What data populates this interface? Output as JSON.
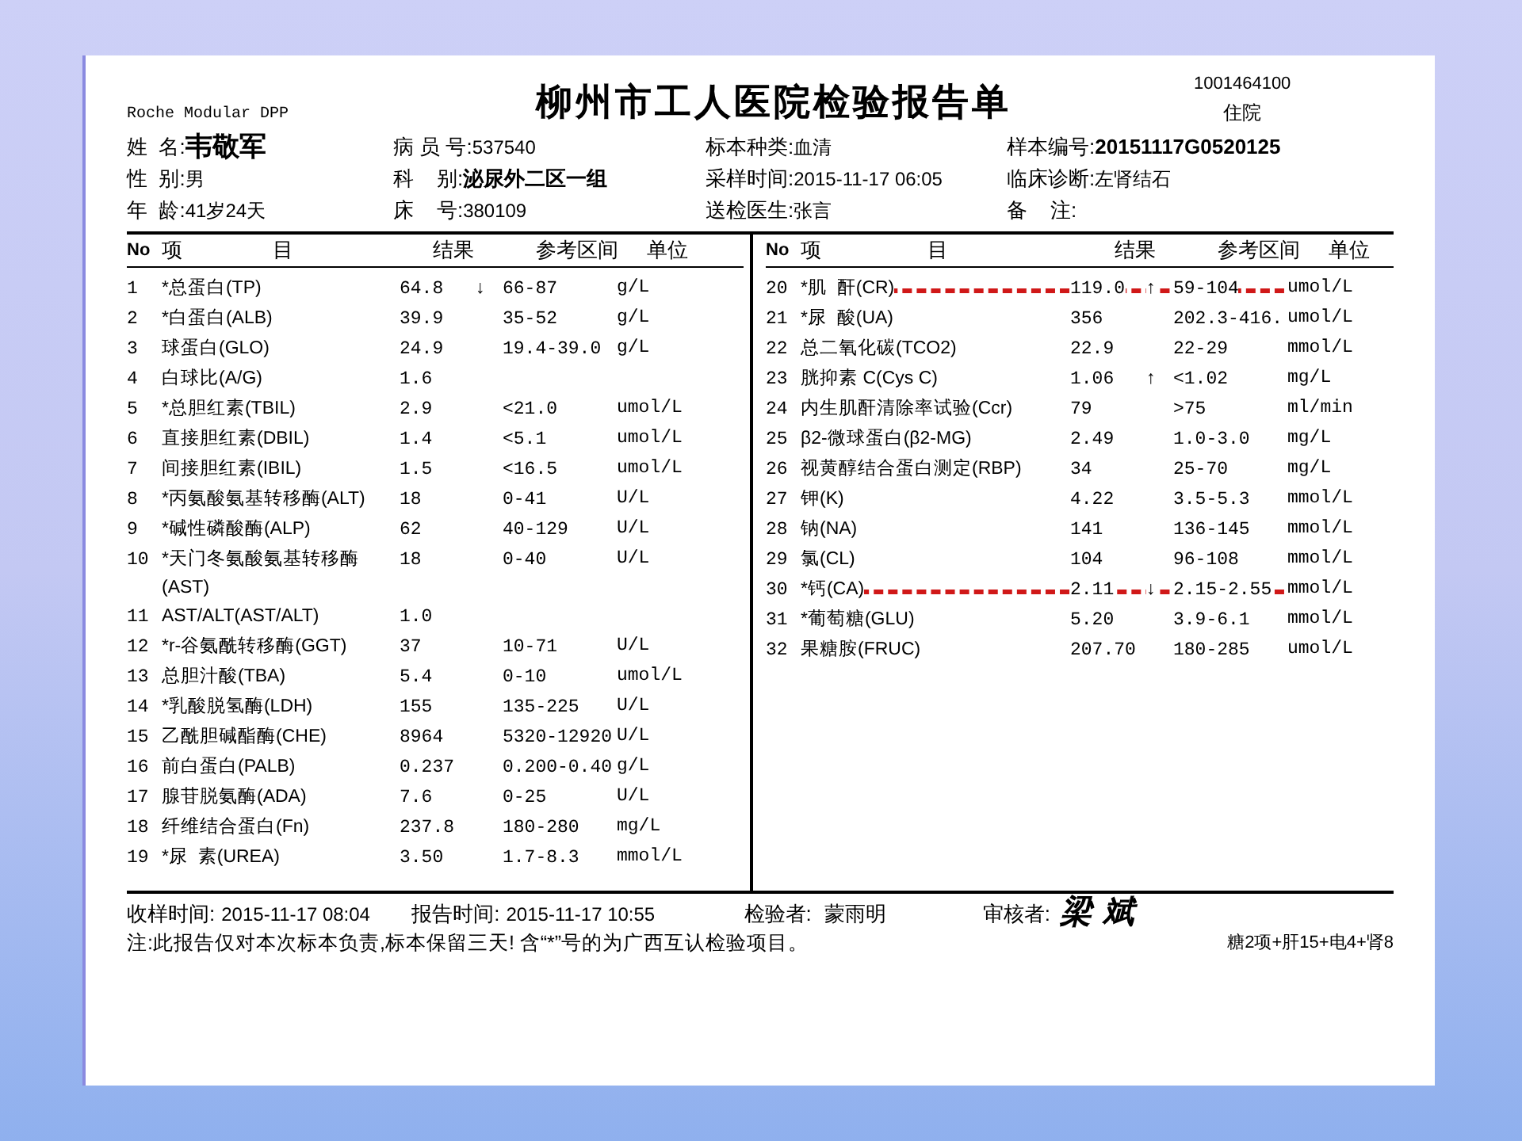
{
  "header": {
    "instrument": "Roche Modular DPP",
    "title": "柳州市工人医院检验报告单",
    "barcode": "1001464100",
    "visit_type": "住院"
  },
  "patient_info": [
    [
      {
        "label": "姓  名:",
        "value": "韦敬军"
      },
      {
        "label": "病 员 号:",
        "value": "537540"
      },
      {
        "label": "标本种类:",
        "value": "血清"
      },
      {
        "label": "样本编号:",
        "value": "20151117G0520125"
      }
    ],
    [
      {
        "label": "性  别:",
        "value": "男"
      },
      {
        "label": "科    别:",
        "value": "泌尿外二区一组"
      },
      {
        "label": "采样时间:",
        "value": "2015-11-17 06:05"
      },
      {
        "label": "临床诊断:",
        "value": "左肾结石"
      }
    ],
    [
      {
        "label": "年  龄:",
        "value": "41岁24天"
      },
      {
        "label": "床    号:",
        "value": "380109"
      },
      {
        "label": "送检医生:",
        "value": "张言"
      },
      {
        "label": "备    注:"
      }
    ]
  ],
  "tables": [
    {
      "columns": [
        "No",
        "项",
        "目",
        "结果",
        "参考区间",
        "单位"
      ],
      "rows": [
        {
          "no": "1",
          "item": "*总蛋白(TP)",
          "result": "64.8",
          "flag": "↓",
          "range": "66-87",
          "unit": "g/L",
          "struck": false
        },
        {
          "no": "2",
          "item": "*白蛋白(ALB)",
          "result": "39.9",
          "range": "35-52",
          "unit": "g/L",
          "struck": false
        },
        {
          "no": "3",
          "item": "球蛋白(GLO)",
          "result": "24.9",
          "range": "19.4-39.0",
          "unit": "g/L",
          "struck": false
        },
        {
          "no": "4",
          "item": "白球比(A/G)",
          "result": "1.6",
          "struck": false
        },
        {
          "no": "5",
          "item": "*总胆红素(TBIL)",
          "result": "2.9",
          "range": "<21.0",
          "unit": "umol/L",
          "struck": false
        },
        {
          "no": "6",
          "item": "直接胆红素(DBIL)",
          "result": "1.4",
          "range": "<5.1",
          "unit": "umol/L",
          "struck": false
        },
        {
          "no": "7",
          "item": "间接胆红素(IBIL)",
          "result": "1.5",
          "range": "<16.5",
          "unit": "umol/L",
          "struck": false
        },
        {
          "no": "8",
          "item": "*丙氨酸氨基转移酶(ALT)",
          "result": "18",
          "range": "0-41",
          "unit": "U/L",
          "struck": false
        },
        {
          "no": "9",
          "item": "*碱性磷酸酶(ALP)",
          "result": "62",
          "range": "40-129",
          "unit": "U/L",
          "struck": false
        },
        {
          "no": "10",
          "item": "*天门冬氨酸氨基转移酶(AST)",
          "result": "18",
          "range": "0-40",
          "unit": "U/L",
          "struck": false
        },
        {
          "no": "11",
          "item": "AST/ALT(AST/ALT)",
          "result": "1.0",
          "struck": false
        },
        {
          "no": "12",
          "item": "*r-谷氨酰转移酶(GGT)",
          "result": "37",
          "range": "10-71",
          "unit": "U/L",
          "struck": false
        },
        {
          "no": "13",
          "item": "总胆汁酸(TBA)",
          "result": "5.4",
          "range": "0-10",
          "unit": "umol/L",
          "struck": false
        },
        {
          "no": "14",
          "item": "*乳酸脱氢酶(LDH)",
          "result": "155",
          "range": "135-225",
          "unit": "U/L",
          "struck": false
        },
        {
          "no": "15",
          "item": "乙酰胆碱酯酶(CHE)",
          "result": "8964",
          "range": "5320-12920",
          "unit": "U/L",
          "struck": false
        },
        {
          "no": "16",
          "item": "前白蛋白(PALB)",
          "result": "0.237",
          "range": "0.200-0.40",
          "unit": "g/L",
          "struck": false
        },
        {
          "no": "17",
          "item": "腺苷脱氨酶(ADA)",
          "result": "7.6",
          "range": "0-25",
          "unit": "U/L",
          "struck": false
        },
        {
          "no": "18",
          "item": "纤维结合蛋白(Fn)",
          "result": "237.8",
          "range": "180-280",
          "unit": "mg/L",
          "struck": false
        },
        {
          "no": "19",
          "item": "*尿  素(UREA)",
          "result": "3.50",
          "range": "1.7-8.3",
          "unit": "mmol/L",
          "struck": false
        }
      ]
    },
    {
      "columns": [
        "No",
        "项",
        "目",
        "结果",
        "参考区间",
        "单位"
      ],
      "rows": [
        {
          "no": "20",
          "item": "*肌  酐(CR)",
          "result": "119.0",
          "flag": "↑",
          "range": "59-104",
          "unit": "umol/L",
          "struck": true
        },
        {
          "no": "21",
          "item": "*尿  酸(UA)",
          "result": "356",
          "range": "202.3-416.",
          "unit": "umol/L",
          "struck": false
        },
        {
          "no": "22",
          "item": "总二氧化碳(TCO2)",
          "result": "22.9",
          "range": "22-29",
          "unit": "mmol/L",
          "struck": false
        },
        {
          "no": "23",
          "item": "胱抑素 C(Cys C)",
          "result": "1.06",
          "flag": "↑",
          "range": "<1.02",
          "unit": "mg/L",
          "struck": false
        },
        {
          "no": "24",
          "item": "内生肌酐清除率试验(Ccr)",
          "result": "79",
          "range": ">75",
          "unit": "ml/min",
          "struck": false
        },
        {
          "no": "25",
          "item": "β2-微球蛋白(β2-MG)",
          "result": "2.49",
          "range": "1.0-3.0",
          "unit": "mg/L",
          "struck": false
        },
        {
          "no": "26",
          "item": "视黄醇结合蛋白测定(RBP)",
          "result": "34",
          "range": "25-70",
          "unit": "mg/L",
          "struck": false
        },
        {
          "no": "27",
          "item": "钾(K)",
          "result": "4.22",
          "range": "3.5-5.3",
          "unit": "mmol/L",
          "struck": false
        },
        {
          "no": "28",
          "item": "钠(NA)",
          "result": "141",
          "range": "136-145",
          "unit": "mmol/L",
          "struck": false
        },
        {
          "no": "29",
          "item": "氯(CL)",
          "result": "104",
          "range": "96-108",
          "unit": "mmol/L",
          "struck": false
        },
        {
          "no": "30",
          "item": "*钙(CA)",
          "result": "2.11",
          "flag": "↓",
          "range": "2.15-2.55",
          "unit": "mmol/L",
          "struck": true
        },
        {
          "no": "31",
          "item": "*葡萄糖(GLU)",
          "result": "5.20",
          "range": "3.9-6.1",
          "unit": "mmol/L",
          "struck": false
        },
        {
          "no": "32",
          "item": "果糖胺(FRUC)",
          "result": "207.70",
          "range": "180-285",
          "unit": "umol/L",
          "struck": false
        }
      ]
    }
  ],
  "footer": {
    "received_label": "收样时间:",
    "received": "2015-11-17 08:04",
    "report_label": "报告时间:",
    "report": "2015-11-17 10:55",
    "tester_label": "检验者:",
    "tester": "蒙雨明",
    "reviewer_label": "审核者:",
    "reviewer_signature": "梁 斌",
    "note": "注:此报告仅对本次标本负责,标本保留三天! 含“*”号的为广西互认检验项目。",
    "panel_summary": "糖2项+肝15+电4+肾8"
  }
}
